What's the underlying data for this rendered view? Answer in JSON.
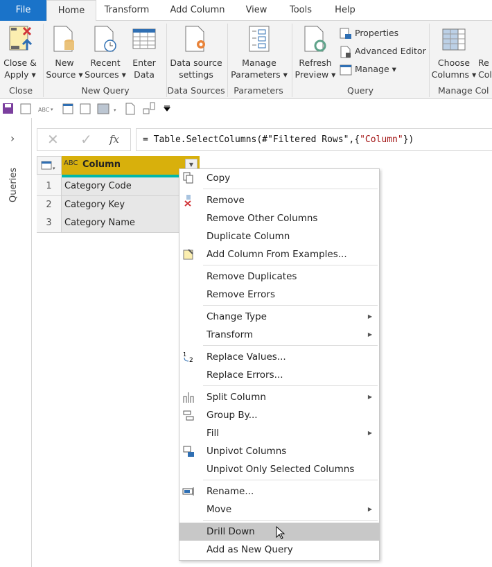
{
  "tabs": [
    "File",
    "Home",
    "Transform",
    "Add Column",
    "View",
    "Tools",
    "Help"
  ],
  "ribbon": {
    "close_apply": "Close &",
    "close_apply2": "Apply",
    "close_group": "Close",
    "new_source": "New",
    "new_source2": "Source",
    "recent": "Recent",
    "recent2": "Sources",
    "enter": "Enter",
    "enter2": "Data",
    "new_query_group": "New Query",
    "ds": "Data source",
    "ds2": "settings",
    "ds_group": "Data Sources",
    "mp": "Manage",
    "mp2": "Parameters",
    "params_group": "Parameters",
    "refresh": "Refresh",
    "refresh2": "Preview",
    "properties": "Properties",
    "advanced": "Advanced Editor",
    "manage": "Manage",
    "query_group": "Query",
    "choose": "Choose",
    "choose2": "Columns",
    "remove_partial": "Re",
    "remove_partial2": "Col",
    "manage_cols_group": "Manage Col"
  },
  "left_pane": {
    "label": "Queries"
  },
  "formula": {
    "prefix": "= Table.SelectColumns(#\"Filtered Rows\",{",
    "string": "\"Column\"",
    "suffix": "})",
    "fx": "fx"
  },
  "table": {
    "header": "Column",
    "type_icon": "ABC",
    "rows": [
      {
        "n": "1",
        "v": "Category Code"
      },
      {
        "n": "2",
        "v": "Category Key"
      },
      {
        "n": "3",
        "v": "Category Name"
      }
    ]
  },
  "menu": [
    {
      "label": "Copy",
      "icon": "copy-icon"
    },
    "-",
    {
      "label": "Remove",
      "icon": "remove-column-icon"
    },
    {
      "label": "Remove Other Columns"
    },
    {
      "label": "Duplicate Column"
    },
    {
      "label": "Add Column From Examples...",
      "icon": "examples-icon"
    },
    "-",
    {
      "label": "Remove Duplicates"
    },
    {
      "label": "Remove Errors"
    },
    "-",
    {
      "label": "Change Type",
      "submenu": true
    },
    {
      "label": "Transform",
      "submenu": true
    },
    "-",
    {
      "label": "Replace Values...",
      "icon": "replace-values-icon"
    },
    {
      "label": "Replace Errors..."
    },
    "-",
    {
      "label": "Split Column",
      "submenu": true,
      "icon": "split-column-icon"
    },
    {
      "label": "Group By...",
      "icon": "group-by-icon"
    },
    {
      "label": "Fill",
      "submenu": true
    },
    {
      "label": "Unpivot Columns",
      "icon": "unpivot-icon"
    },
    {
      "label": "Unpivot Only Selected Columns"
    },
    "-",
    {
      "label": "Rename...",
      "icon": "rename-icon"
    },
    {
      "label": "Move",
      "submenu": true
    },
    "-",
    {
      "label": "Drill Down",
      "highlighted": true
    },
    {
      "label": "Add as New Query"
    }
  ],
  "colors": {
    "file_tab": "#1a73c9",
    "header": "#d8b00c",
    "quality_bar": "#00b7a8",
    "highlight": "#c8c8c8"
  }
}
